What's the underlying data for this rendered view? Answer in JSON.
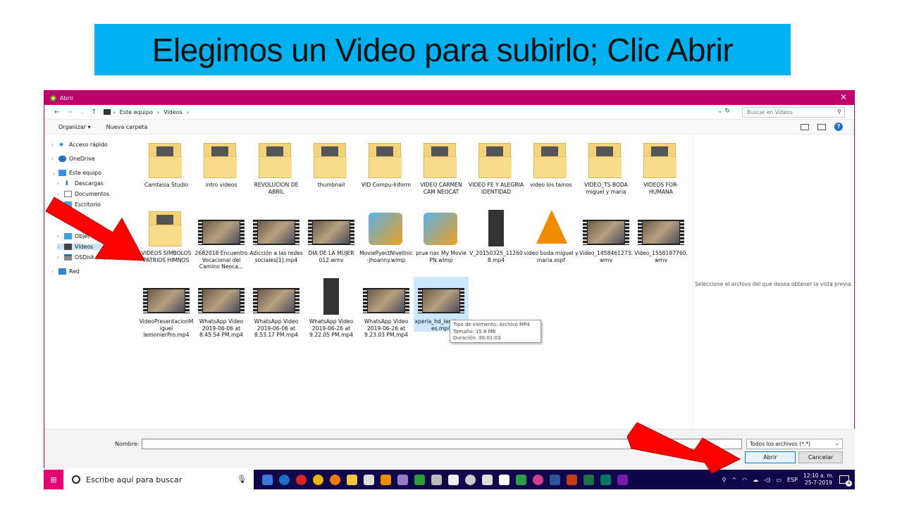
{
  "banner": {
    "title": "Elegimos un Video para subirlo; Clic Abrir"
  },
  "dialog": {
    "title": "Abrir",
    "breadcrumb": [
      "Este equipo",
      "Vídeos"
    ],
    "search_placeholder": "Buscar en Vídeos",
    "commands": {
      "organize": "Organizar ▾",
      "new_folder": "Nueva carpeta"
    },
    "nav": [
      {
        "label": "Acceso rápido",
        "icon": "star-icon"
      },
      {
        "label": "OneDrive",
        "icon": "cloud-icon"
      },
      {
        "label": "Este equipo",
        "icon": "computer-icon"
      },
      {
        "label": "Descargas",
        "icon": "download-icon"
      },
      {
        "label": "Documentos",
        "icon": "document-icon"
      },
      {
        "label": "Escritorio",
        "icon": "desktop-icon"
      },
      {
        "label": "Objet",
        "icon": "cube-icon"
      },
      {
        "label": "Vídeos",
        "icon": "video-folder-icon"
      },
      {
        "label": "OSDisk (C:)",
        "icon": "disk-icon"
      },
      {
        "label": "Red",
        "icon": "network-icon"
      }
    ],
    "files": [
      {
        "name": "Camtasia Studio",
        "kind": "folder"
      },
      {
        "name": "intro videos",
        "kind": "folder"
      },
      {
        "name": "REVOLUCION DE ABRIL",
        "kind": "folder"
      },
      {
        "name": "thumbnail",
        "kind": "folder"
      },
      {
        "name": "VID Compu-Inform",
        "kind": "folder"
      },
      {
        "name": "VIDEO CARMEN CAM NEOCAT",
        "kind": "folder"
      },
      {
        "name": "VIDEO FE Y ALEGRIA IDENTIDAD",
        "kind": "folder"
      },
      {
        "name": "video los tainos",
        "kind": "folder"
      },
      {
        "name": "VIDEO_TS BODA miguel y maria",
        "kind": "folder"
      },
      {
        "name": "VIDEOS FOR-HUMANA",
        "kind": "folder"
      },
      {
        "name": "VIDEOS SIMBOLOS PATRIOS HIMNOS",
        "kind": "folder"
      },
      {
        "name": "2682018 Encuentro Vocacional del Camino Neoca...",
        "kind": "video"
      },
      {
        "name": "Adicción a las redes sociales[1].mp4",
        "kind": "video"
      },
      {
        "name": "DIA DE LA MUJER 012.wmv",
        "kind": "video"
      },
      {
        "name": "MoviePyectNivellnic-jhoanny.wlmp",
        "kind": "movie"
      },
      {
        "name": "prue nac My Movie PN.wlmp",
        "kind": "movie"
      },
      {
        "name": "V_20150325_112608.mp4",
        "kind": "phone"
      },
      {
        "name": "video boda miguel y maria.xspf",
        "kind": "cone"
      },
      {
        "name": "Video_1458461273.wmv",
        "kind": "video"
      },
      {
        "name": "Video_1558187760.wmv",
        "kind": "video"
      },
      {
        "name": "VideoPresentacionMiguel lemonierPro.mp4",
        "kind": "video"
      },
      {
        "name": "WhatsApp Video 2019-06-06 at 8.45.54 PM.mp4",
        "kind": "video"
      },
      {
        "name": "WhatsApp Video 2019-06-06 at 8.53.17 PM.mp4",
        "kind": "video"
      },
      {
        "name": "WhatsApp Video 2019-06-26 at 9.22.05 PM.mp4",
        "kind": "phone"
      },
      {
        "name": "WhatsApp Video 2019-06-26 at 9.23.03 PM.mp4",
        "kind": "video"
      },
      {
        "name": "xperia_hd_landscapes.mp4",
        "kind": "video",
        "selected": true
      }
    ],
    "tooltip": {
      "line1": "Tipo de elemento: Archivo MP4",
      "line2": "Tamaño: 15.8 MB",
      "line3": "Duración: 00:01:03"
    },
    "preview_text": "Seleccione el archivo del que desea obtener la vista previa.",
    "name_label": "Nombre:",
    "file_type": "Todos los archivos (*.*)",
    "open_label": "Abrir",
    "cancel_label": "Cancelar"
  },
  "taskbar": {
    "search_placeholder": "Escribe aquí para buscar",
    "lang": "ESP",
    "time": "12:10 a. m.",
    "date": "25-7-2019",
    "notifications": "4"
  },
  "colors": {
    "banner": "#00b0f0",
    "titlebar": "#c0006a",
    "taskbar": "#10074b",
    "arrow": "#ff0000"
  }
}
